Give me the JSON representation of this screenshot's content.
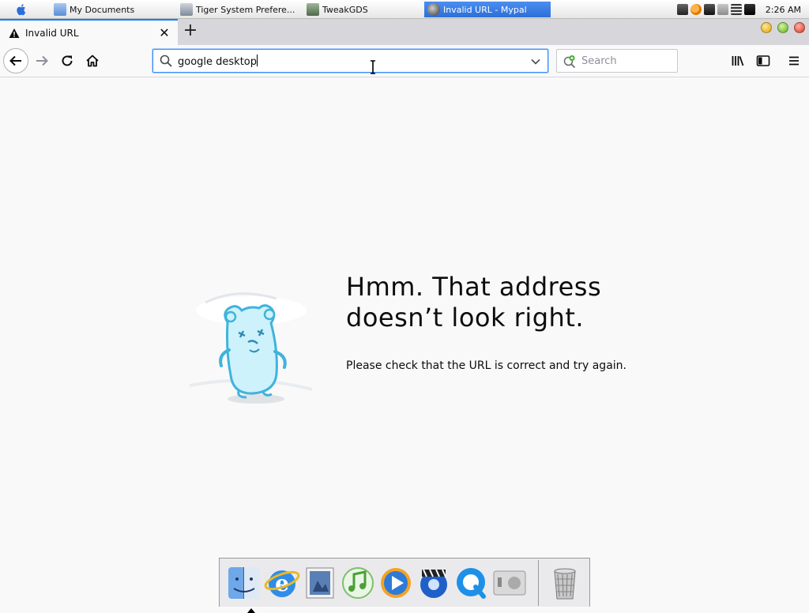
{
  "os_taskbar": {
    "apple_menu_icon": "apple-logo-icon",
    "tasks": [
      {
        "label": "My Documents",
        "icon": "folder-icon",
        "active": false
      },
      {
        "label": "Tiger System Prefere...",
        "icon": "system-preferences-icon",
        "active": false
      },
      {
        "label": "TweakGDS",
        "icon": "tweak-icon",
        "active": false
      },
      {
        "label": "Invalid URL - Mypal",
        "icon": "mypal-browser-icon",
        "active": true
      }
    ],
    "tray_icons": [
      "keyboard-icon",
      "search-tray-icon",
      "network-icon",
      "display-icon",
      "volume-icon",
      "chat-icon"
    ],
    "clock": "2:26 AM"
  },
  "browser": {
    "tab": {
      "title": "Invalid URL",
      "icon": "warning-icon",
      "close_label": "✕"
    },
    "new_tab_label": "+",
    "window_controls": [
      "minimize",
      "zoom",
      "close"
    ],
    "urlbar": {
      "value": "google desktop"
    },
    "searchbar": {
      "placeholder": "Search"
    },
    "toolbar_icons": [
      "library-icon",
      "sidebar-icon",
      "menu-icon"
    ]
  },
  "error_page": {
    "title_line1": "Hmm. That address",
    "title_line2": "doesn’t look right.",
    "description": "Please check that the URL is correct and try again."
  },
  "dock": {
    "items": [
      "finder-icon",
      "internet-explorer-icon",
      "preview-icon",
      "itunes-icon",
      "media-player-icon",
      "dvd-player-icon",
      "quicktime-icon",
      "boot-camp-icon",
      "trash-icon"
    ]
  },
  "colors": {
    "accent": "#0a84ff",
    "page_background": "#f9f9fa",
    "taskbar_active": "#2d6fd8"
  }
}
